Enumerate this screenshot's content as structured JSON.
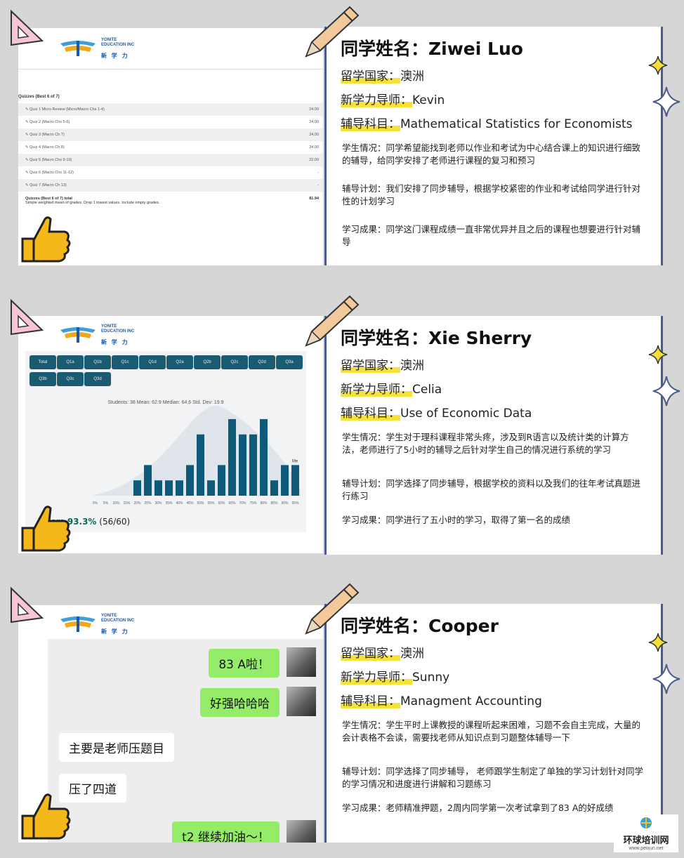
{
  "logo": {
    "text_en": "YONITE\nEDUCATION INC",
    "text_cn": "新 学 力"
  },
  "labels": {
    "name": "同学姓名：",
    "country": "留学国家：",
    "tutor": "新学力导师：",
    "subject": "辅导科目："
  },
  "cards": [
    {
      "student": "Ziwei Luo",
      "country": "澳洲",
      "tutor": "Kevin",
      "subject": "Mathematical Statistics for Economists",
      "situation": "学生情况：同学希望能找到老师以作业和考试为中心结合课上的知识进行细致的辅导，给同学安排了老师进行课程的复习和预习",
      "plan": "辅导计划：我们安排了同步辅导，根据学校紧密的作业和考试给同学进行针对性的计划学习",
      "result": "学习成果：同学这门课程成绩一直非常优异并且之后的课程也想要进行针对辅导"
    },
    {
      "student": "Xie Sherry",
      "country": "澳洲",
      "tutor": "Celia",
      "subject": "Use of Economic Data",
      "situation": "学生情况：学生对于理科课程非常头疼，涉及到R语言以及统计类的计算方法，老师进行了5小时的辅导之后针对学生自己的情况进行系统的学习",
      "plan": "辅导计划：同学选择了同步辅导，根据学校的资料以及我们的往年考试真题进行练习",
      "result": "学习成果：同学进行了五小时的学习，取得了第一名的成绩"
    },
    {
      "student": "Cooper",
      "country": "澳洲",
      "tutor": "Sunny",
      "subject": "Managment Accounting",
      "situation": "学生情况：学生平时上课教授的课程听起来困难，习题不会自主完成，大量的会计表格不会读，需要找老师从知识点到习题整体辅导一下",
      "plan": "辅导计划：同学选择了同步辅导， 老师跟学生制定了单独的学习计划针对同学的学习情况和进度进行讲解和习题练习",
      "result": "学习成果：老师精准押题，2周内同学第一次考试拿到了83 A的好成绩"
    }
  ],
  "quiz": {
    "heading": "Quizzes (Best 6 of 7)",
    "rows": [
      {
        "name": "Quiz 1 Micro Review (Micro/Macro Chs 1-4)",
        "score": "24.00"
      },
      {
        "name": "Quiz 2 (Macro Chs 5-6)",
        "score": "24.00"
      },
      {
        "name": "Quiz 3 (Macro Ch 7)",
        "score": "24.00"
      },
      {
        "name": "Quiz 4 (Macro Ch 8)",
        "score": "24.00"
      },
      {
        "name": "Quiz 5 (Macro Chs 9-10)",
        "score": "22.00"
      },
      {
        "name": "Quiz 6 (Macro Chs 11-12)",
        "score": "-"
      },
      {
        "name": "Quiz 7 (Macro Ch 13)",
        "score": "-"
      }
    ],
    "total_label": "Quizzes (Best 6 of 7) total",
    "total_desc": "Simple weighted mean of grades. Drop 1 lowest values. Include empty grades.",
    "total_score": "81.94"
  },
  "chart": {
    "buttons": [
      "Total",
      "Q1a",
      "Q1b",
      "Q1c",
      "Q1d",
      "Q2a",
      "Q2b",
      "Q2c",
      "Q2d",
      "Q3a",
      "Q3b",
      "Q3c",
      "Q3d"
    ],
    "stats": "Students: 38   Mean: 62.9   Median: 64.6   Std. Dev: 19.9",
    "me_label": "Me",
    "score_prefix": "core",
    "score_value": "93.3%",
    "score_suffix": "(56/60)"
  },
  "chart_data": {
    "type": "bar",
    "categories": [
      "0%",
      "5%",
      "10%",
      "15%",
      "20%",
      "25%",
      "30%",
      "35%",
      "40%",
      "45%",
      "50%",
      "55%",
      "60%",
      "65%",
      "70%",
      "75%",
      "80%",
      "85%",
      "90%",
      "95%"
    ],
    "values": [
      0,
      0,
      0,
      0,
      1,
      2,
      1,
      1,
      1,
      2,
      4,
      1,
      2,
      5,
      4,
      4,
      5,
      1,
      2,
      2
    ],
    "ylim": [
      0,
      5.5
    ],
    "grid": false,
    "color": "#0f5a78"
  },
  "chat": {
    "messages": [
      {
        "side": "right",
        "text": "83 A啦！"
      },
      {
        "side": "right",
        "text": "好强哈哈哈"
      },
      {
        "side": "left",
        "text": "主要是老师压题目"
      },
      {
        "side": "left",
        "text": "压了四道"
      },
      {
        "side": "right",
        "text": "t2 继续加油～！"
      }
    ]
  },
  "watermark": {
    "cn": "环球培训网",
    "url": "www.peixun.net"
  },
  "colors": {
    "accent_blue": "#4b5b8f",
    "highlight": "#f5e33a",
    "bar": "#0f5a78",
    "wechat_green": "#95ec69"
  }
}
